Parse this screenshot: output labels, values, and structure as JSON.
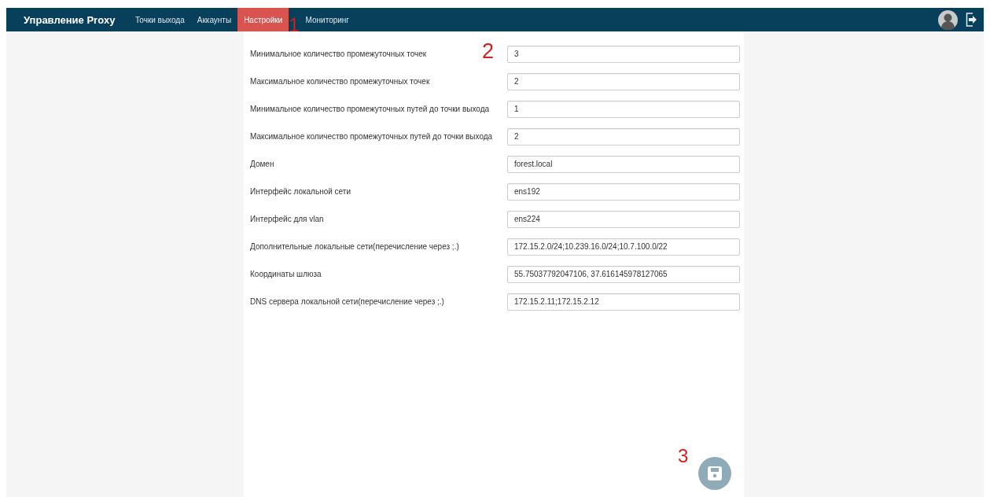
{
  "navbar": {
    "brand": "Управление Proxy",
    "tabs": [
      {
        "label": "Точки выхода",
        "selected": false
      },
      {
        "label": "Аккаунты",
        "selected": false
      },
      {
        "label": "Настройки",
        "selected": true
      },
      {
        "label": "Мониторинг",
        "selected": false
      }
    ]
  },
  "settings": [
    {
      "label": "Минимальное количество промежуточных точек",
      "value": "3"
    },
    {
      "label": "Максимальное количество промежуточных точек",
      "value": "2"
    },
    {
      "label": "Минимальное количество промежуточных путей до точки выхода",
      "value": "1"
    },
    {
      "label": "Максимальное количество промежуточных путей до точки выхода",
      "value": "2"
    },
    {
      "label": "Домен",
      "value": "forest.local"
    },
    {
      "label": "Интерфейс локальной сети",
      "value": "ens192"
    },
    {
      "label": "Интерфейс для vlan",
      "value": "ens224"
    },
    {
      "label": "Дополнительные локальные сети(перечисление через ;.)",
      "value": "172.15.2.0/24;10.239.16.0/24;10.7.100.0/22"
    },
    {
      "label": "Координаты шлюза",
      "value": "55.75037792047106, 37.616145978127065"
    },
    {
      "label": "DNS сервера локальной сети(перечисление через ;.)",
      "value": "172.15.2.11;172.15.2.12"
    }
  ],
  "annotations": [
    "1",
    "2",
    "3"
  ]
}
